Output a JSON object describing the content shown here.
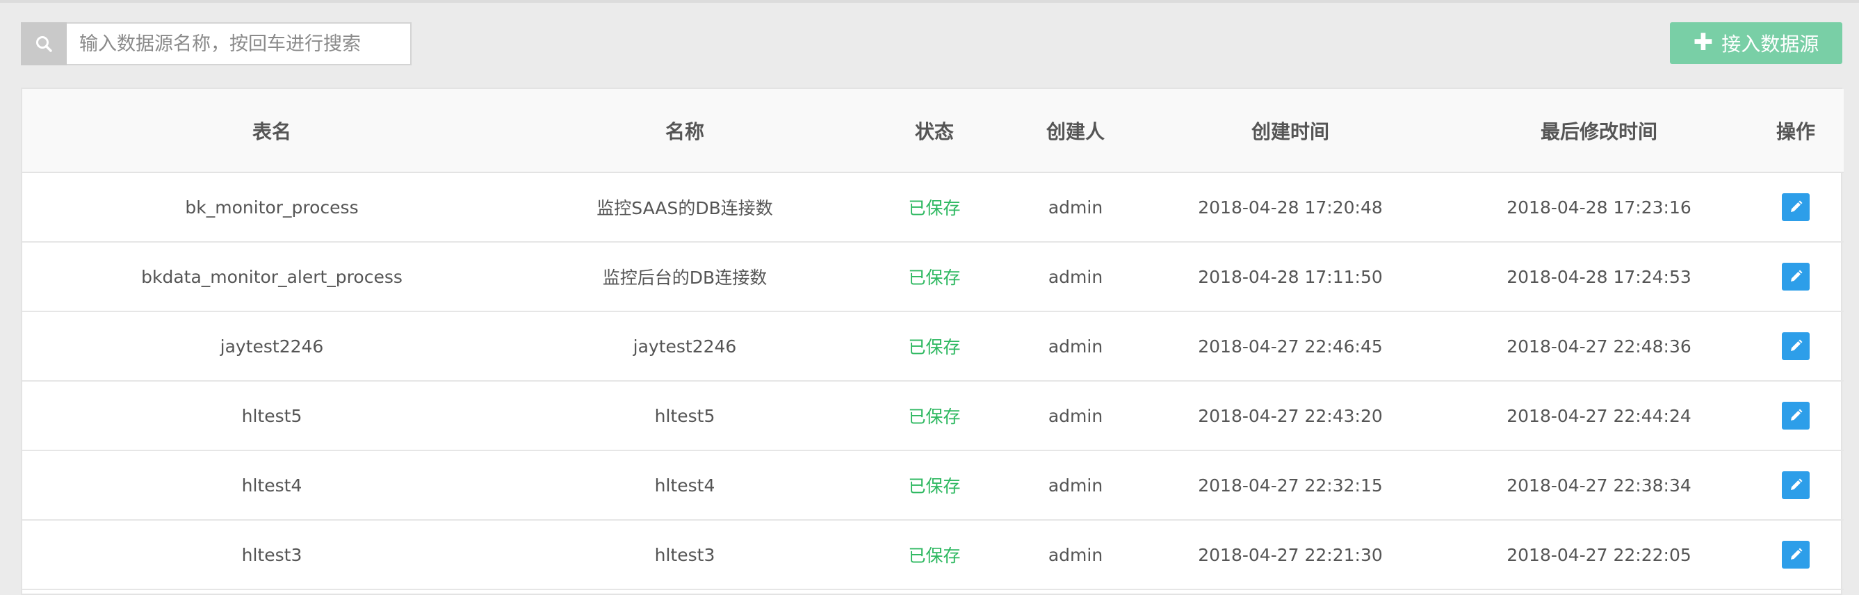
{
  "search": {
    "placeholder": "输入数据源名称，按回车进行搜索",
    "icon": "search-icon"
  },
  "actions": {
    "add_label": "接入数据源",
    "add_icon": "plus-icon"
  },
  "colors": {
    "add_button": "#79cfa6",
    "status_saved": "#2db860",
    "edit_button": "#2d9ee9"
  },
  "table": {
    "headers": [
      "表名",
      "名称",
      "状态",
      "创建人",
      "创建时间",
      "最后修改时间",
      "操作"
    ],
    "rows": [
      {
        "table_name": "bk_monitor_process",
        "name": "监控SAAS的DB连接数",
        "status": "已保存",
        "creator": "admin",
        "created": "2018-04-28 17:20:48",
        "modified": "2018-04-28 17:23:16",
        "action_icon": "pencil-icon"
      },
      {
        "table_name": "bkdata_monitor_alert_process",
        "name": "监控后台的DB连接数",
        "status": "已保存",
        "creator": "admin",
        "created": "2018-04-28 17:11:50",
        "modified": "2018-04-28 17:24:53",
        "action_icon": "pencil-icon"
      },
      {
        "table_name": "jaytest2246",
        "name": "jaytest2246",
        "status": "已保存",
        "creator": "admin",
        "created": "2018-04-27 22:46:45",
        "modified": "2018-04-27 22:48:36",
        "action_icon": "pencil-icon"
      },
      {
        "table_name": "hltest5",
        "name": "hltest5",
        "status": "已保存",
        "creator": "admin",
        "created": "2018-04-27 22:43:20",
        "modified": "2018-04-27 22:44:24",
        "action_icon": "pencil-icon"
      },
      {
        "table_name": "hltest4",
        "name": "hltest4",
        "status": "已保存",
        "creator": "admin",
        "created": "2018-04-27 22:32:15",
        "modified": "2018-04-27 22:38:34",
        "action_icon": "pencil-icon"
      },
      {
        "table_name": "hltest3",
        "name": "hltest3",
        "status": "已保存",
        "creator": "admin",
        "created": "2018-04-27 22:21:30",
        "modified": "2018-04-27 22:22:05",
        "action_icon": "pencil-icon"
      }
    ]
  }
}
